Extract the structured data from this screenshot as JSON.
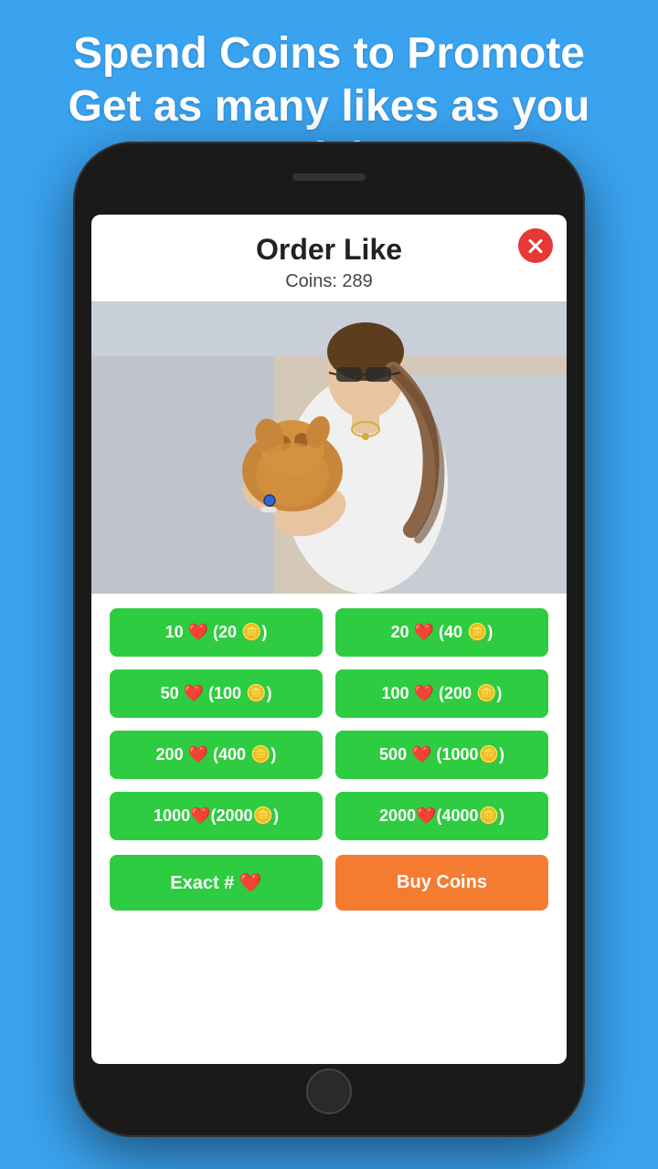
{
  "background": {
    "color": "#3aa3f0"
  },
  "header": {
    "line1": "Spend Coins to Promote",
    "line2": "Get as many likes as you wish"
  },
  "modal": {
    "title": "Order Like",
    "coins_label": "Coins: 289",
    "close_label": "✕"
  },
  "order_buttons": [
    {
      "id": "btn-10",
      "label": "10 ❤️ (20 🪙)"
    },
    {
      "id": "btn-20",
      "label": "20 ❤️ (40 🪙)"
    },
    {
      "id": "btn-50",
      "label": "50 ❤️ (100 🪙)"
    },
    {
      "id": "btn-100",
      "label": "100 ❤️ (200 🪙)"
    },
    {
      "id": "btn-200",
      "label": "200 ❤️ (400 🪙)"
    },
    {
      "id": "btn-500",
      "label": "500 ❤️ (1000🪙)"
    },
    {
      "id": "btn-1000",
      "label": "1000❤️(2000🪙)"
    },
    {
      "id": "btn-2000",
      "label": "2000❤️(4000🪙)"
    }
  ],
  "bottom_actions": {
    "exact_label": "Exact  # ❤️",
    "buy_label": "Buy  Coins"
  }
}
